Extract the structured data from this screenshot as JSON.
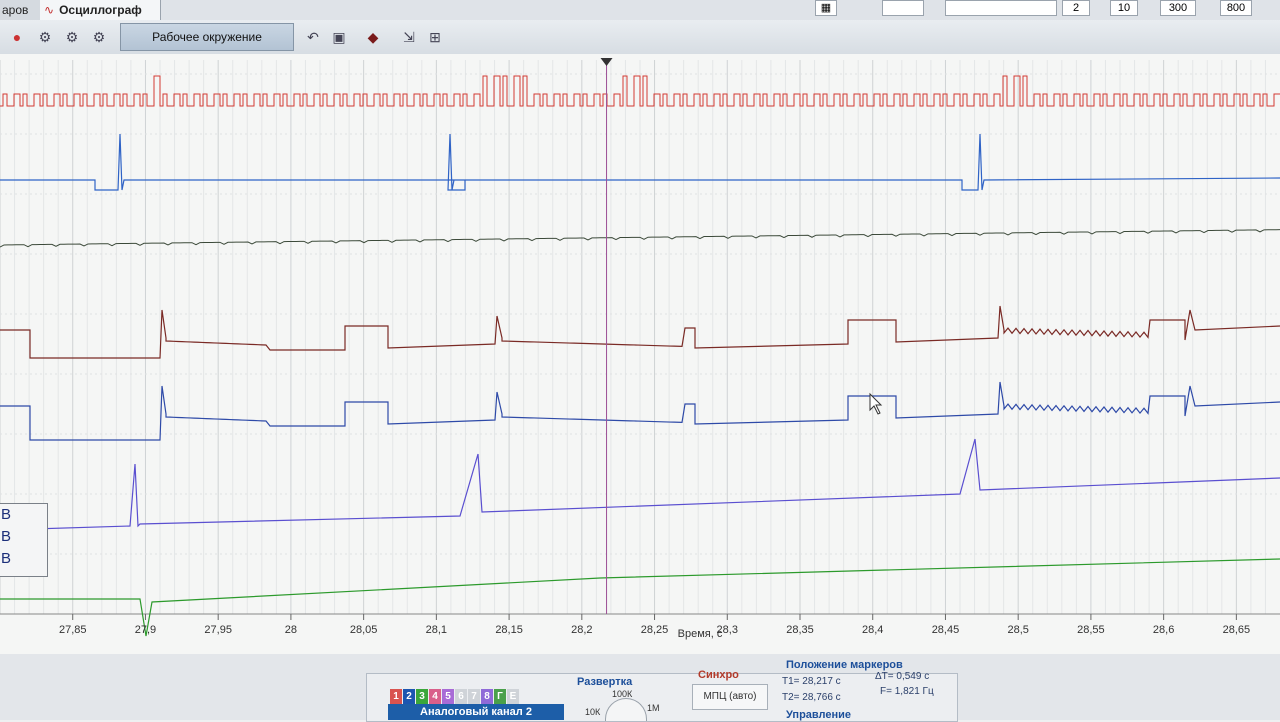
{
  "window": {
    "tab_left": "аров",
    "tab_active": "Осциллограф",
    "top_values": [
      "10",
      "300",
      "800",
      "2"
    ]
  },
  "toolbar": {
    "environment": "Рабочее окружение"
  },
  "plot": {
    "x_axis": {
      "label": "Время, с",
      "range": [
        27.8,
        28.68
      ],
      "ticks": [
        "27,85",
        "27,9",
        "27,95",
        "28",
        "28,05",
        "28,1",
        "28,15",
        "28,2",
        "28,25",
        "28,3",
        "28,35",
        "28,4",
        "28,45",
        "28,5",
        "28,55",
        "28,6",
        "28,65"
      ]
    },
    "marker_time": 28.217,
    "channel_units": [
      "В",
      "В",
      "В"
    ],
    "trace_colors": [
      "#d23a32",
      "#2f63c6",
      "#3c4a3a",
      "#7a2a25",
      "#2e4aa8",
      "#5a4fd0",
      "#2c9a2c"
    ]
  },
  "controls": {
    "channels": [
      "1",
      "2",
      "3",
      "4",
      "5",
      "6",
      "7",
      "8",
      "Г",
      "Е"
    ],
    "channel_colors": [
      "#d9534f",
      "#1c56b0",
      "#3aa63a",
      "#d95f8a",
      "#a86bd6",
      "#cfd3d8",
      "#cfd3d8",
      "#8f6ad8",
      "#4aa04a",
      "#cfd3d8"
    ],
    "selected_channel": "Аналоговый канал 2",
    "sweep_title": "Развертка",
    "sweep_labels": [
      "100К",
      "10К",
      "1М"
    ],
    "sync_title": "Синхро",
    "sync_value": "МПЦ (авто)",
    "markers_title": "Положение маркеров",
    "t1": "T1= 28,217 с",
    "t2": "T2= 28,766 с",
    "dt": "ΔT= 0,549 с",
    "freq": "F= 1,821 Гц",
    "control_title": "Управление"
  }
}
